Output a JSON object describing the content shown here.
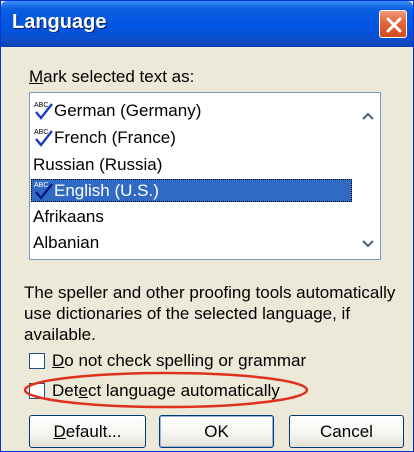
{
  "dialog": {
    "title": "Language"
  },
  "mark_label": {
    "prefix": "M",
    "rest": "ark selected text as:"
  },
  "languages": [
    {
      "label": "German (Germany)",
      "spell_icon": "abc-check-icon",
      "selected": false
    },
    {
      "label": "French (France)",
      "spell_icon": "abc-check-icon",
      "selected": false
    },
    {
      "label": "Russian (Russia)",
      "spell_icon": "",
      "selected": false
    },
    {
      "label": "English (U.S.)",
      "spell_icon": "abc-check-icon",
      "selected": true
    },
    {
      "label": "Afrikaans",
      "spell_icon": "",
      "selected": false
    },
    {
      "label": "Albanian",
      "spell_icon": "",
      "selected": false
    }
  ],
  "help_text": "The speller and other proofing tools automatically use dictionaries of the selected language, if available.",
  "checkboxes": {
    "no_check": {
      "prefix": "D",
      "rest": "o not check spelling or grammar",
      "checked": false
    },
    "detect": {
      "prefix": "Det",
      "u": "e",
      "rest": "ct language automatically",
      "checked": false
    }
  },
  "buttons": {
    "default": {
      "u": "D",
      "rest": "efault..."
    },
    "ok": "OK",
    "cancel": "Cancel"
  },
  "colors": {
    "titlebar": "#0054e3",
    "selection": "#316ac5",
    "highlight_ellipse": "#e0301e"
  }
}
